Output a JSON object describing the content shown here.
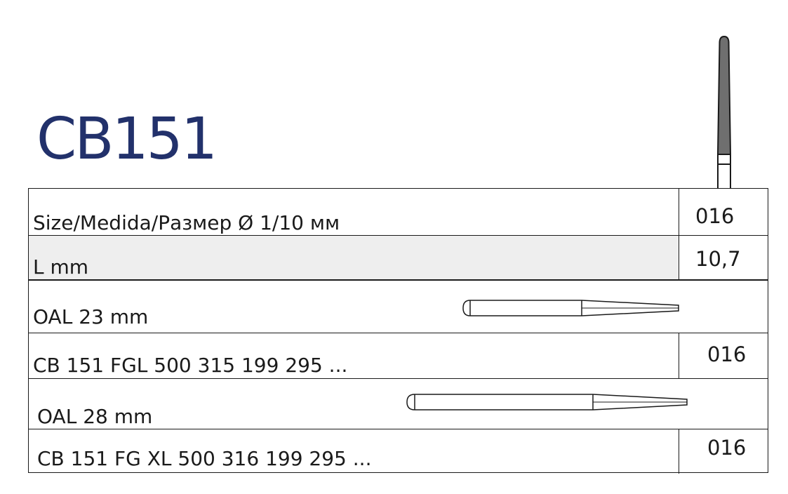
{
  "product": {
    "code": "CB151"
  },
  "specs": {
    "size_label": "Size/Medida/Размер Ø 1/10 мм",
    "size_value": "016",
    "length_label": "L mm",
    "length_value": "10,7"
  },
  "variants": [
    {
      "oal_label": "OAL 23 mm",
      "ref_label": "CB 151 FGL 500 315 199 295 ...",
      "ref_value": "016"
    },
    {
      "oal_label": "OAL 28 mm",
      "ref_label": "CB 151 FG XL 500 316 199 295 ...",
      "ref_value": "016"
    }
  ],
  "colors": {
    "brand": "#22316b",
    "line": "#1a1a1a",
    "shade": "#eeeeee",
    "bur_head": "#6f6f6f"
  }
}
